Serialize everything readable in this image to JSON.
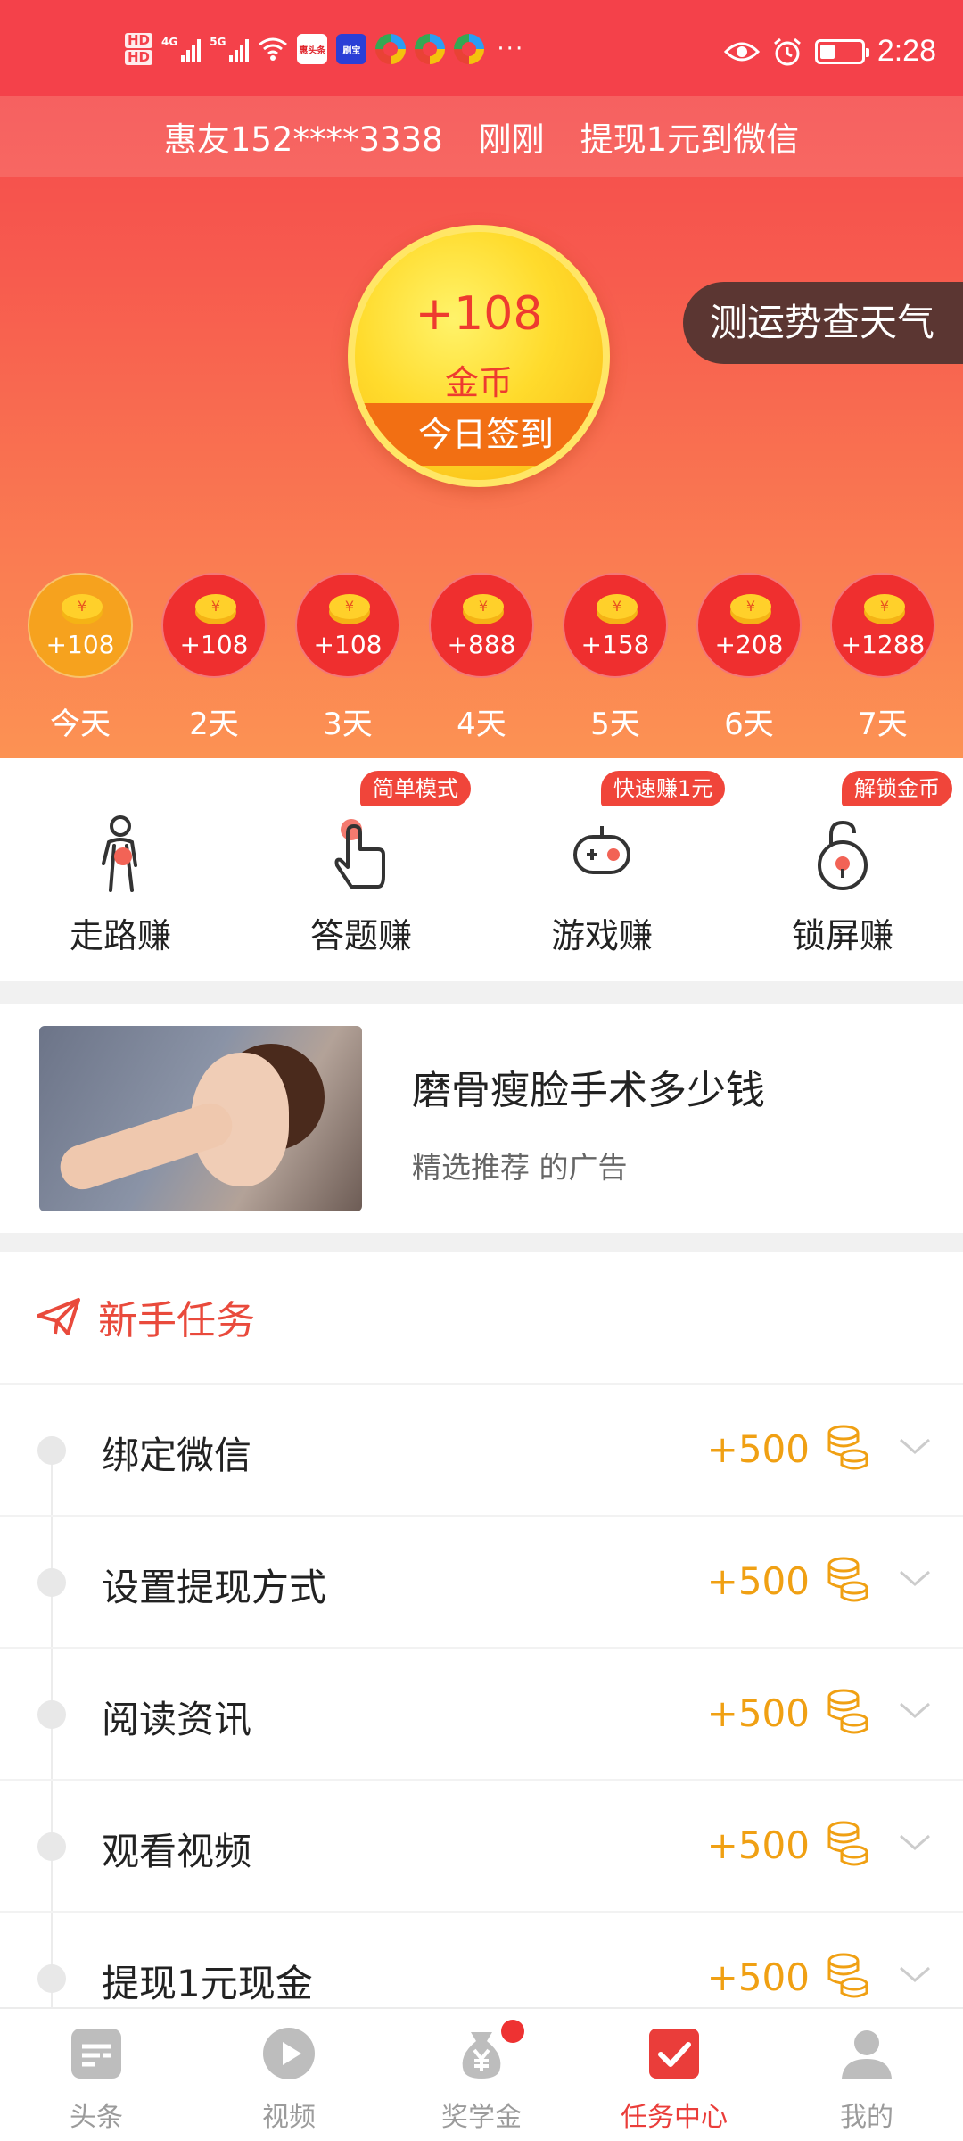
{
  "status_bar": {
    "hd1": "HD",
    "hd2": "HD",
    "net1": "4G",
    "net2": "5G",
    "app1": "惠头条",
    "app2": "刷宝",
    "more": "···",
    "time": "2:28"
  },
  "ticker": {
    "user": "惠友152****3338",
    "when": "刚刚",
    "action": "提现1元到微信"
  },
  "checkin": {
    "amount": "+108",
    "unit": "金币",
    "button": "今日签到"
  },
  "weather_button": "测运势查天气",
  "days": [
    {
      "value": "+108",
      "label": "今天"
    },
    {
      "value": "+108",
      "label": "2天"
    },
    {
      "value": "+108",
      "label": "3天"
    },
    {
      "value": "+888",
      "label": "4天"
    },
    {
      "value": "+158",
      "label": "5天"
    },
    {
      "value": "+208",
      "label": "6天"
    },
    {
      "value": "+1288",
      "label": "7天"
    }
  ],
  "earn": [
    {
      "label": "走路赚",
      "tag": ""
    },
    {
      "label": "答题赚",
      "tag": "简单模式"
    },
    {
      "label": "游戏赚",
      "tag": "快速赚1元"
    },
    {
      "label": "锁屏赚",
      "tag": "解锁金币"
    }
  ],
  "ad": {
    "title": "磨骨瘦脸手术多少钱",
    "subtitle": "精选推荐 的广告"
  },
  "tasks": {
    "header": "新手任务",
    "items": [
      {
        "name": "绑定微信",
        "points": "+500"
      },
      {
        "name": "设置提现方式",
        "points": "+500"
      },
      {
        "name": "阅读资讯",
        "points": "+500"
      },
      {
        "name": "观看视频",
        "points": "+500"
      },
      {
        "name": "提现1元现金",
        "points": "+500"
      }
    ]
  },
  "nav": [
    {
      "label": "头条",
      "icon": "headline-icon"
    },
    {
      "label": "视频",
      "icon": "play-icon"
    },
    {
      "label": "奖学金",
      "icon": "money-bag-icon"
    },
    {
      "label": "任务中心",
      "icon": "checkbox-icon"
    },
    {
      "label": "我的",
      "icon": "person-icon"
    }
  ],
  "colors": {
    "primary_red": "#f4434a",
    "coin_orange": "#f0a013",
    "active_nav": "#ea3d3a"
  }
}
